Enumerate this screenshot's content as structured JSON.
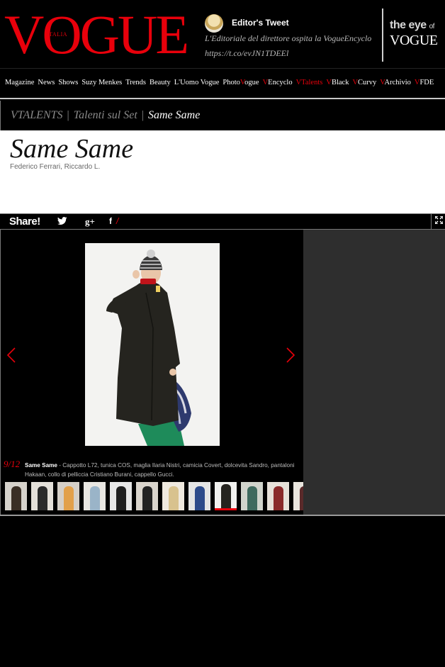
{
  "header": {
    "logo_text": "VOGUE",
    "logo_sub": "ITALIA",
    "tweet_title": "Editor's Tweet",
    "tweet_line1": "L'Editoriale del direttore ospita la VogueEncyclo",
    "tweet_line2": "https://t.co/evJN1TDEEl",
    "eye_line1": "the eye",
    "eye_of": "of",
    "eye_line2": "VOGUE"
  },
  "nav": {
    "items": [
      {
        "prefix": "",
        "label": "Magazine"
      },
      {
        "prefix": "",
        "label": "News"
      },
      {
        "prefix": "",
        "label": "Shows"
      },
      {
        "prefix": "",
        "label": "Suzy Menkes"
      },
      {
        "prefix": "",
        "label": "Trends"
      },
      {
        "prefix": "",
        "label": "Beauty"
      },
      {
        "prefix": "",
        "label": "L'Uomo Vogue"
      },
      {
        "prefix": "Photo",
        "v": "V",
        "label": "ogue"
      },
      {
        "prefix": "",
        "v": "V",
        "label": "Encyclo"
      },
      {
        "prefix": "",
        "v": "V",
        "label": "Talents"
      },
      {
        "prefix": "",
        "v": "V",
        "label": "Black"
      },
      {
        "prefix": "",
        "v": "V",
        "label": "Curvy"
      },
      {
        "prefix": "",
        "v": "V",
        "label": "Archivio"
      },
      {
        "prefix": "",
        "v": "V",
        "label": "FDE"
      }
    ]
  },
  "breadcrumb": {
    "items": [
      "VTALENTS",
      "Talenti sul Set",
      "Same Same"
    ],
    "separator": "|"
  },
  "article": {
    "title": "Same Same",
    "authors": "Federico Ferrari, Riccardo L."
  },
  "share": {
    "label": "Share!",
    "twitter_icon": "twitter-bird-icon",
    "gplus_label": "g+",
    "facebook_label": "f",
    "facebook_slash": "/"
  },
  "gallery": {
    "counter": "9/12",
    "caption_title": "Same Same",
    "caption_text": " - Cappotto L72, tunica COS, maglia Ilaria Nistri, camicia Covert, dolcevita Sandro, pantaloni Hakaan, collo di pelliccia Cristiano Burani, cappello Gucci.",
    "prev_icon": "chevron-left-icon",
    "next_icon": "chevron-right-icon",
    "active_thumb": 9,
    "thumb_count": 12
  },
  "colors": {
    "accent": "#e8000b",
    "background": "#000000",
    "panel": "#2e2e2e"
  }
}
